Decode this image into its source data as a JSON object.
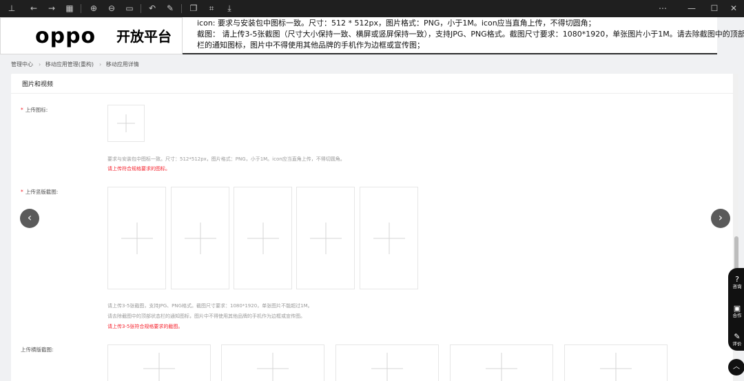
{
  "toolbar": {
    "icons": [
      "pin-icon",
      "back-icon",
      "forward-icon",
      "grid-icon",
      "zoom-in-icon",
      "zoom-out-icon",
      "fit-icon",
      "rotate-icon",
      "edit-icon",
      "layers-icon",
      "crop-icon",
      "save-icon",
      "more-icon",
      "minimize-icon",
      "maximize-icon",
      "close-icon"
    ]
  },
  "header": {
    "logo": "oppo",
    "logo_subtitle": "开放平台",
    "note_icon": "icon: 要求与安装包中图标一致。尺寸：512 * 512px，图片格式：PNG，小于1M。icon应当直角上传，不得切圆角；",
    "note_shot_1": "截图：  请上传3-5张截图（尺寸大小保持一致、横屏或竖屏保持一致），支持JPG、PNG格式。截图尺寸要求：1080*1920，单张图片小于1M。请去除截图中的顶部状态",
    "note_shot_2": "栏的通知图标，图片中不得使用其他品牌的手机作为边框或宣传图；"
  },
  "breadcrumb": [
    "管理中心",
    "移动应用管理(重构)",
    "移动应用详情"
  ],
  "section": {
    "title": "图片和视频"
  },
  "icon_field": {
    "required": "*",
    "label": "上传图标:",
    "hint": "要求与安装包中图标一致。尺寸：512*512px，图片格式：PNG，小于1M。icon应当直角上传，不得切圆角。",
    "error": "请上传符合规格要求的图标。"
  },
  "portrait_field": {
    "required": "*",
    "label": "上传竖版截图:",
    "hint_1": "请上传3-5张截图，支持JPG、PNG格式。截图尺寸要求：1080*1920，单张图片不能超过1M。",
    "hint_2": "请去除截图中的顶部状态栏的通知图标，图片中不得使用其他品牌的手机作为边框或宣传图。",
    "error": "请上传3-5张符合规格要求的截图。"
  },
  "landscape_field": {
    "label": "上传横版截图:"
  },
  "carousel": {
    "prev": "‹",
    "next": "›"
  },
  "side_panel": {
    "items": [
      {
        "icon": "?",
        "label": "咨询"
      },
      {
        "icon": "▣",
        "label": "合作"
      },
      {
        "icon": "✎",
        "label": "评价"
      }
    ],
    "top": "︿"
  }
}
